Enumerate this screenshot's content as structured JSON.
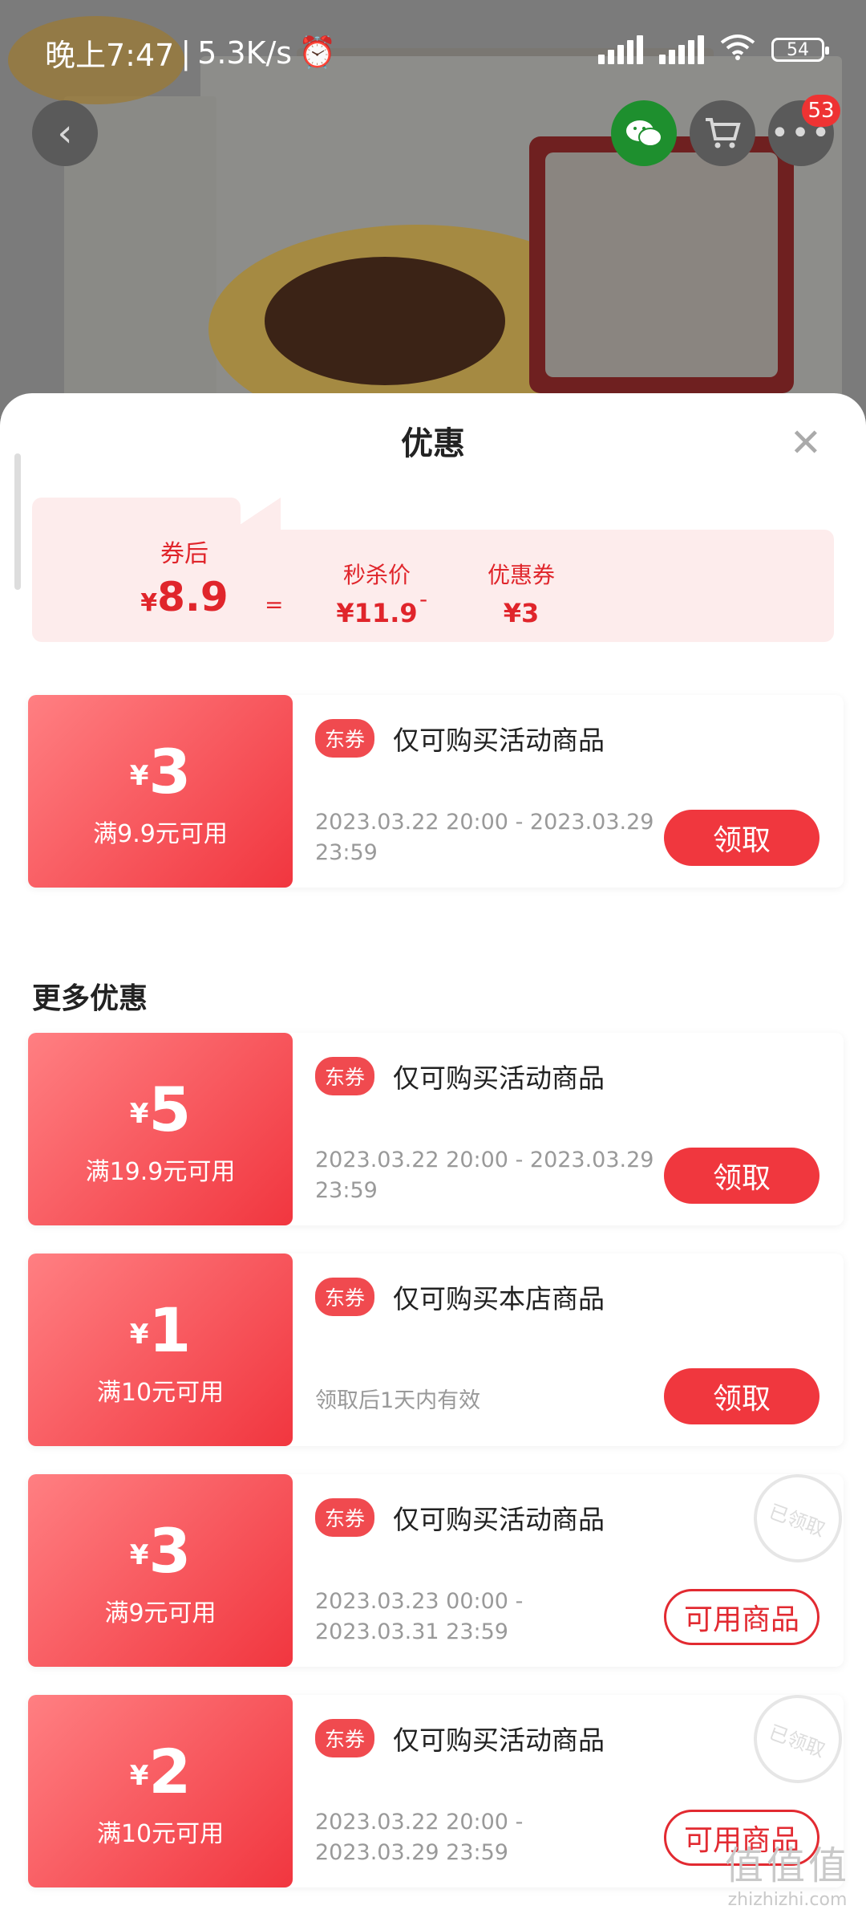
{
  "status_bar": {
    "time": "晚上7:47",
    "speed": "5.3K/s",
    "battery": "54"
  },
  "header": {
    "cart_badge": "53"
  },
  "sheet": {
    "title": "优惠",
    "summary": {
      "after_label": "券后",
      "after_currency": "¥",
      "after_price": "8.9",
      "equals": "=",
      "seckill_label": "秒杀价",
      "seckill_value": "¥11.9",
      "minus": "-",
      "coupon_label": "优惠券",
      "coupon_value": "¥3"
    },
    "more_title": "更多优惠",
    "coupons": [
      {
        "currency": "¥",
        "amount": "3",
        "condition": "满9.9元可用",
        "tag": "东券",
        "desc": "仅可购买活动商品",
        "time": "2023.03.22 20:00 - 2023.03.29 23:59",
        "button": "领取",
        "claimed": false
      },
      {
        "currency": "¥",
        "amount": "5",
        "condition": "满19.9元可用",
        "tag": "东券",
        "desc": "仅可购买活动商品",
        "time": "2023.03.22 20:00 - 2023.03.29 23:59",
        "button": "领取",
        "claimed": false
      },
      {
        "currency": "¥",
        "amount": "1",
        "condition": "满10元可用",
        "tag": "东券",
        "desc": "仅可购买本店商品",
        "time": "领取后1天内有效",
        "button": "领取",
        "claimed": false
      },
      {
        "currency": "¥",
        "amount": "3",
        "condition": "满9元可用",
        "tag": "东券",
        "desc": "仅可购买活动商品",
        "time": "2023.03.23 00:00 - 2023.03.31 23:59",
        "button": "可用商品",
        "claimed": true,
        "stamp": "已领取"
      },
      {
        "currency": "¥",
        "amount": "2",
        "condition": "满10元可用",
        "tag": "东券",
        "desc": "仅可购买活动商品",
        "time": "2023.03.22 20:00 - 2023.03.29 23:59",
        "button": "可用商品",
        "claimed": true,
        "stamp": "已领取"
      }
    ]
  },
  "watermark": {
    "big": "值值值",
    "small": "zhizhizhi.com"
  },
  "colors": {
    "accent": "#f0373e",
    "summary_bg": "#fdecec"
  }
}
